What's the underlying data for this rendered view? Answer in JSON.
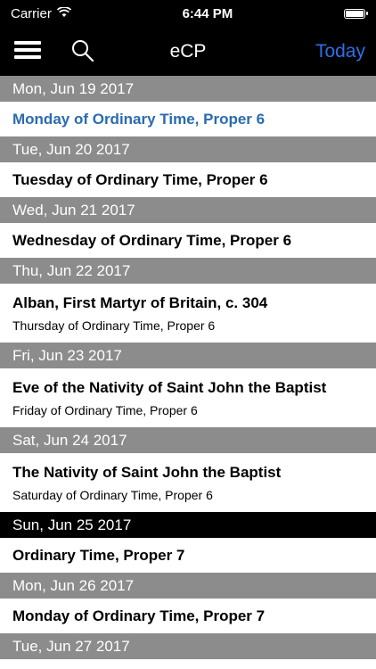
{
  "status_bar": {
    "carrier": "Carrier",
    "time": "6:44 PM"
  },
  "nav": {
    "title": "eCP",
    "today_label": "Today"
  },
  "days": [
    {
      "date": "Mon, Jun 19 2017",
      "title": "Monday of Ordinary Time, Proper 6",
      "subtitle": "",
      "selected": true
    },
    {
      "date": "Tue, Jun 20 2017",
      "title": "Tuesday of Ordinary Time, Proper 6",
      "subtitle": ""
    },
    {
      "date": "Wed, Jun 21 2017",
      "title": "Wednesday of Ordinary Time, Proper 6",
      "subtitle": ""
    },
    {
      "date": "Thu, Jun 22 2017",
      "title": "Alban, First Martyr of Britain, c. 304",
      "subtitle": "Thursday of Ordinary Time, Proper 6"
    },
    {
      "date": "Fri, Jun 23 2017",
      "title": "Eve of the Nativity of Saint John the Baptist",
      "subtitle": "Friday of Ordinary Time, Proper 6"
    },
    {
      "date": "Sat, Jun 24 2017",
      "title": "The Nativity of Saint John the Baptist",
      "subtitle": "Saturday of Ordinary Time, Proper 6"
    },
    {
      "date": "Sun, Jun 25 2017",
      "title": "Ordinary Time, Proper 7",
      "subtitle": "",
      "sunday": true
    },
    {
      "date": "Mon, Jun 26 2017",
      "title": "Monday of Ordinary Time, Proper 7",
      "subtitle": ""
    },
    {
      "date": "Tue, Jun 27 2017",
      "title": "",
      "subtitle": ""
    }
  ],
  "colors": {
    "header_gray": "#8c8c8c",
    "sunday_header": "#000000",
    "accent": "#2f6fe8",
    "selected_text": "#2a6bb0"
  }
}
